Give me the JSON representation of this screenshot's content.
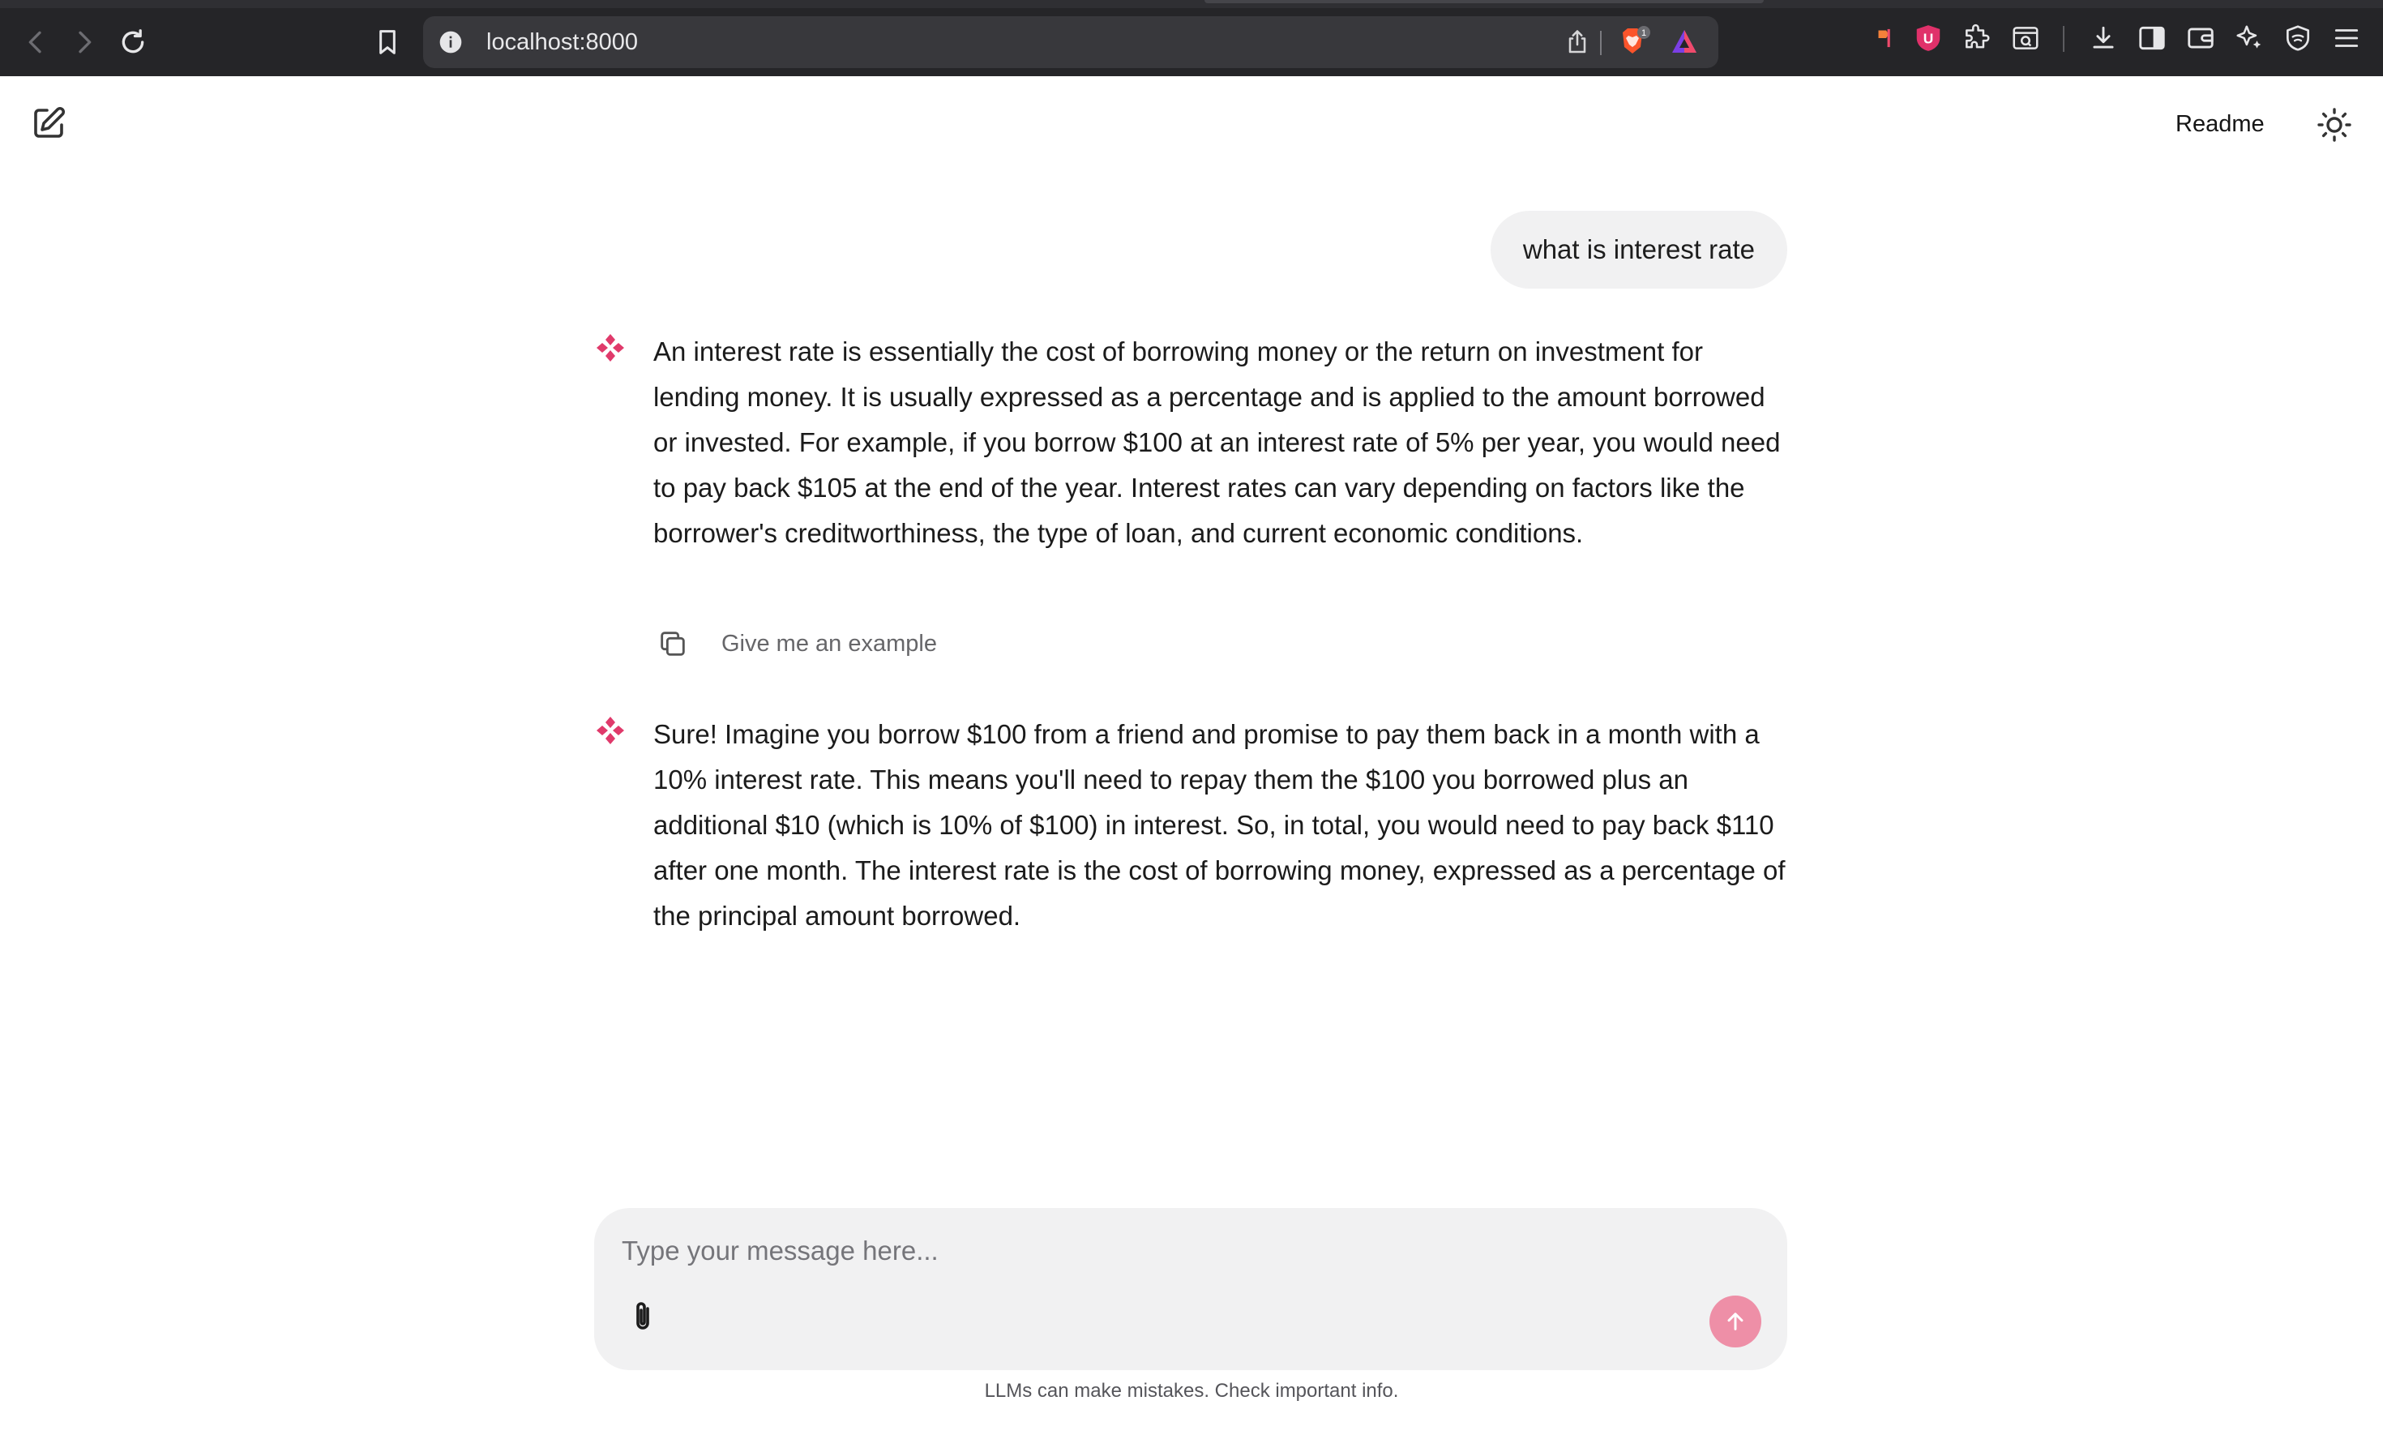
{
  "browser": {
    "url": "localhost:8000",
    "shield_badge_count": "1",
    "theme": {
      "chrome_bg": "#252528",
      "urlbar_bg": "#38383c",
      "brave_orange": "#fb542b"
    }
  },
  "header": {
    "readme_label": "Readme"
  },
  "conversation": {
    "user_message": "what is interest rate",
    "assistant_messages": [
      {
        "text": "An interest rate is essentially the cost of borrowing money or the return on investment for lending money. It is usually expressed as a percentage and is applied to the amount borrowed or invested. For example, if you borrow $100 at an interest rate of 5% per year, you would need to pay back $105 at the end of the year. Interest rates can vary depending on factors like the borrower's creditworthiness, the type of loan, and current economic conditions."
      },
      {
        "text": "Sure! Imagine you borrow $100 from a friend and promise to pay them back in a month with a 10% interest rate. This means you'll need to repay them the $100 you borrowed plus an additional $10 (which is 10% of $100) in interest. So, in total, you would need to pay back $110 after one month. The interest rate is the cost of borrowing money, expressed as a percentage of the principal amount borrowed."
      }
    ],
    "follow_up_suggestion": "Give me an example"
  },
  "composer": {
    "placeholder": "Type your message here...",
    "value": ""
  },
  "footer": {
    "disclaimer": "LLMs can make mistakes. Check important info."
  },
  "colors": {
    "accent": "#e03a6b",
    "send_button": "#ee8fa7",
    "bubble_bg": "#f1f1f2"
  },
  "icons": {
    "new_chat": "edit-square-icon",
    "theme_toggle": "sun-icon",
    "assistant_logo": "four-dot-logo-icon",
    "copy": "copy-icon",
    "attach": "paperclip-icon",
    "send": "arrow-up-icon"
  }
}
